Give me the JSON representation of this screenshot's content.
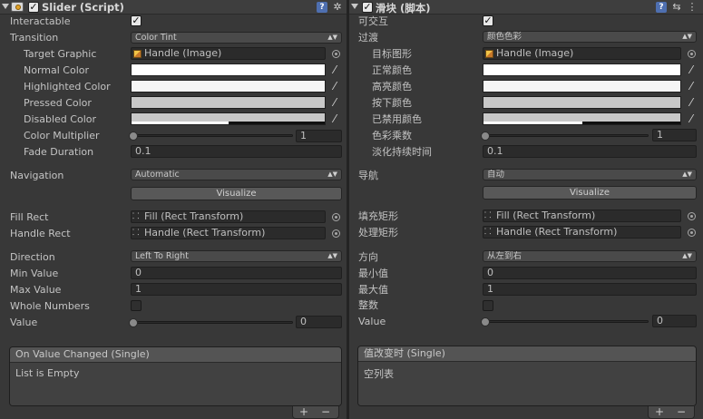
{
  "left": {
    "header": {
      "title": "Slider (Script)",
      "enabled": true
    },
    "labels": {
      "interactable": "Interactable",
      "transition": "Transition",
      "target_graphic": "Target Graphic",
      "normal_color": "Normal Color",
      "highlighted_color": "Highlighted Color",
      "pressed_color": "Pressed Color",
      "disabled_color": "Disabled Color",
      "color_multiplier": "Color Multiplier",
      "fade_duration": "Fade Duration",
      "navigation": "Navigation",
      "fill_rect": "Fill Rect",
      "handle_rect": "Handle Rect",
      "direction": "Direction",
      "min_value": "Min Value",
      "max_value": "Max Value",
      "whole_numbers": "Whole Numbers",
      "value": "Value"
    },
    "values": {
      "interactable": true,
      "transition": "Color Tint",
      "target_graphic": "Handle (Image)",
      "normal_color": "#ffffff",
      "highlighted_color": "#f5f5f5",
      "pressed_color": "#c8c8c8",
      "disabled_color": "#c8c8c8",
      "disabled_alpha": 0.5,
      "color_multiplier": "1",
      "color_multiplier_level": 0,
      "fade_duration": "0.1",
      "navigation": "Automatic",
      "visualize": "Visualize",
      "fill_rect": "Fill (Rect Transform)",
      "handle_rect": "Handle (Rect Transform)",
      "direction": "Left To Right",
      "min_value": "0",
      "max_value": "1",
      "whole_numbers": false,
      "value": "0",
      "value_level": 0
    },
    "event": {
      "title": "On Value Changed (Single)",
      "body": "List is Empty",
      "plus": "+",
      "minus": "−"
    }
  },
  "right": {
    "header": {
      "title": "滑块 (脚本)",
      "enabled": true
    },
    "labels": {
      "interactable": "可交互",
      "transition": "过渡",
      "target_graphic": "目标图形",
      "normal_color": "正常颜色",
      "highlighted_color": "高亮颜色",
      "pressed_color": "按下颜色",
      "disabled_color": "已禁用颜色",
      "color_multiplier": "色彩乘数",
      "fade_duration": "淡化持续时间",
      "navigation": "导航",
      "fill_rect": "填充矩形",
      "handle_rect": "处理矩形",
      "direction": "方向",
      "min_value": "最小值",
      "max_value": "最大值",
      "whole_numbers": "整数",
      "value": "Value"
    },
    "values": {
      "interactable": true,
      "transition": "颜色色彩",
      "target_graphic": "Handle (Image)",
      "normal_color": "#ffffff",
      "highlighted_color": "#f5f5f5",
      "pressed_color": "#c8c8c8",
      "disabled_color": "#c8c8c8",
      "disabled_alpha": 0.5,
      "color_multiplier": "1",
      "color_multiplier_level": 0,
      "fade_duration": "0.1",
      "navigation": "自动",
      "visualize": "Visualize",
      "fill_rect": "Fill (Rect Transform)",
      "handle_rect": "Handle (Rect Transform)",
      "direction": "从左到右",
      "min_value": "0",
      "max_value": "1",
      "whole_numbers": false,
      "value": "0",
      "value_level": 0
    },
    "event": {
      "title": "值改变时 (Single)",
      "body": "空列表",
      "plus": "+",
      "minus": "−"
    }
  },
  "icons": {
    "fold": "foldout-arrow-icon",
    "script": "script-component-icon",
    "help": "help-book-icon",
    "preset": "preset-icon",
    "settings": "gear-icon",
    "picker": "object-picker-icon",
    "eyedropper": "eyedropper-icon"
  },
  "colors": {
    "panel_bg": "#383838",
    "field_bg": "#2b2b2b",
    "help_blue": "#4e6fb0"
  }
}
